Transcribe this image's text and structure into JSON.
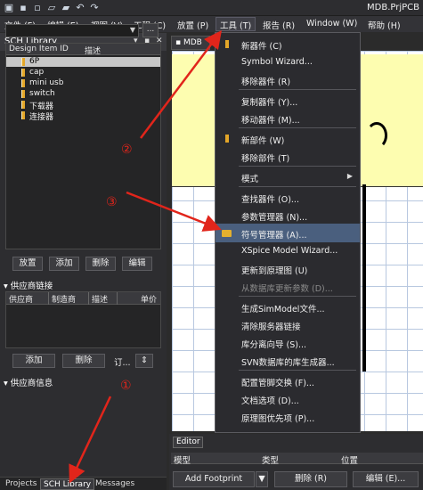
{
  "window": {
    "title": "MDB.PrjPCB"
  },
  "menubar": {
    "items": [
      "文件 (F)",
      "编辑 (E)",
      "视图 (V)",
      "工程 (C)",
      "放置 (P)",
      "工具 (T)",
      "报告 (R)",
      "Window (W)",
      "帮助 (H)"
    ]
  },
  "panel": {
    "title": "SCH Library",
    "combo_value": "",
    "dots_label": "...",
    "tree_headers": [
      "Design Item ID",
      "描述"
    ],
    "tree_items": [
      "6P",
      "cap",
      "mini usb",
      "switch",
      "下载器",
      "连接器"
    ],
    "buttons": [
      "放置",
      "添加",
      "删除",
      "编辑"
    ],
    "supplier_link_title": "供应商链接",
    "supplier_headers": [
      "供应商",
      "制造商",
      "描述",
      "单价"
    ],
    "supplier_buttons": [
      "添加",
      "删除",
      "订..."
    ],
    "supplier_info_title": "供应商信息",
    "bottom_tabs": [
      "Projects",
      "SCH Library",
      "Messages"
    ]
  },
  "document_tab": {
    "label": "MDB"
  },
  "editor": {
    "tab": "Editor",
    "headers": [
      "模型",
      "类型",
      "位置"
    ],
    "add_footprint": "Add Footprint",
    "delete_button": "删除 (R)",
    "edit_button": "编辑 (E)..."
  },
  "tools_menu": {
    "items": [
      {
        "label": "新器件 (C)",
        "icon": "bar"
      },
      {
        "label": "Symbol Wizard..."
      },
      {
        "label": "移除器件 (R)"
      },
      {
        "sep": true
      },
      {
        "label": "复制器件 (Y)..."
      },
      {
        "label": "移动器件 (M)..."
      },
      {
        "sep": true
      },
      {
        "label": "新部件 (W)",
        "icon": "bar"
      },
      {
        "label": "移除部件 (T)"
      },
      {
        "sep": true
      },
      {
        "label": "模式",
        "submenu": true
      },
      {
        "sep": true
      },
      {
        "label": "查找器件 (O)..."
      },
      {
        "label": "参数管理器 (N)..."
      },
      {
        "label": "符号管理器 (A)...",
        "icon": "folder",
        "highlight": true
      },
      {
        "label": "XSpice Model Wizard..."
      },
      {
        "label": "更新到原理图 (U)"
      },
      {
        "label": "从数据库更新参数 (D)...",
        "disabled": true
      },
      {
        "sep": true
      },
      {
        "label": "生成SimModel文件..."
      },
      {
        "label": "清除服务器链接"
      },
      {
        "label": "库分离向导 (S)..."
      },
      {
        "label": "SVN数据库的库生成器..."
      },
      {
        "sep": true
      },
      {
        "label": "配置管脚交换 (F)..."
      },
      {
        "label": "文档选项 (D)..."
      },
      {
        "label": "原理图优先项 (P)..."
      }
    ]
  },
  "annotations": [
    "①",
    "②",
    "③"
  ],
  "colors": {
    "highlight": "#4a5f7e",
    "annotation_red": "#e1251b",
    "sheet_yellow": "#fdfdb0"
  }
}
